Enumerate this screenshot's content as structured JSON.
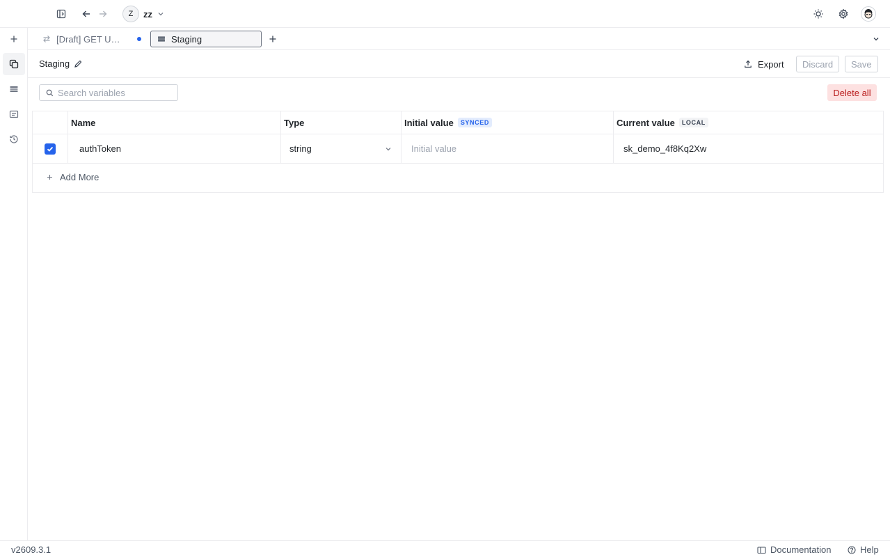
{
  "workspace": {
    "avatar_letter": "Z",
    "name": "zz"
  },
  "tabs": [
    {
      "label": "[Draft] GET Untitled",
      "icon": "rest-arrows-icon",
      "unsaved": true
    },
    {
      "label": "Staging",
      "icon": "environment-icon",
      "active": true
    }
  ],
  "environment": {
    "name": "Staging",
    "export_label": "Export",
    "discard_label": "Discard",
    "save_label": "Save"
  },
  "search": {
    "placeholder": "Search variables",
    "value": ""
  },
  "delete_all_label": "Delete all",
  "table": {
    "headers": {
      "name": "Name",
      "type": "Type",
      "initial": "Initial value",
      "initial_badge": "SYNCED",
      "current": "Current value",
      "current_badge": "LOCAL"
    },
    "rows": [
      {
        "enabled": true,
        "name": "authToken",
        "type": "string",
        "initial_value": "",
        "initial_placeholder": "Initial value",
        "current_value": "sk_demo_4f8Kq2Xw"
      }
    ],
    "add_more_label": "Add More"
  },
  "statusbar": {
    "version": "v2609.3.1",
    "documentation_label": "Documentation",
    "help_label": "Help"
  },
  "colors": {
    "accent": "#2563eb",
    "danger": "#b91c1c",
    "danger_bg": "#fde1e1",
    "border": "#ececef"
  }
}
